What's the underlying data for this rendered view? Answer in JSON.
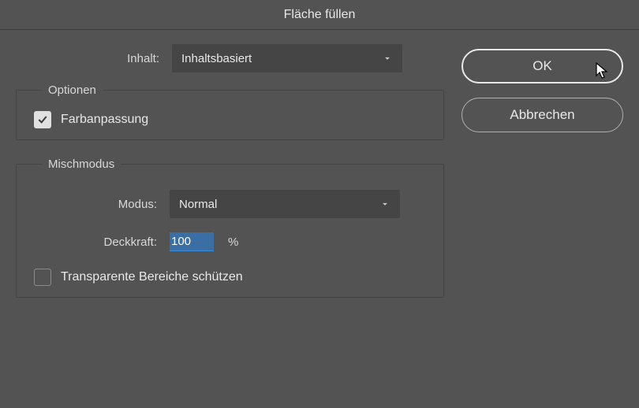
{
  "title": "Fläche füllen",
  "inhalt": {
    "label": "Inhalt:",
    "value": "Inhaltsbasiert"
  },
  "optionen": {
    "legend": "Optionen",
    "farbanpassung": {
      "label": "Farbanpassung",
      "checked": true
    }
  },
  "mischmodus": {
    "legend": "Mischmodus",
    "modus": {
      "label": "Modus:",
      "value": "Normal"
    },
    "deckkraft": {
      "label": "Deckkraft:",
      "value": "100",
      "unit": "%"
    },
    "protect": {
      "label": "Transparente Bereiche schützen",
      "checked": false
    }
  },
  "buttons": {
    "ok": "OK",
    "cancel": "Abbrechen"
  }
}
